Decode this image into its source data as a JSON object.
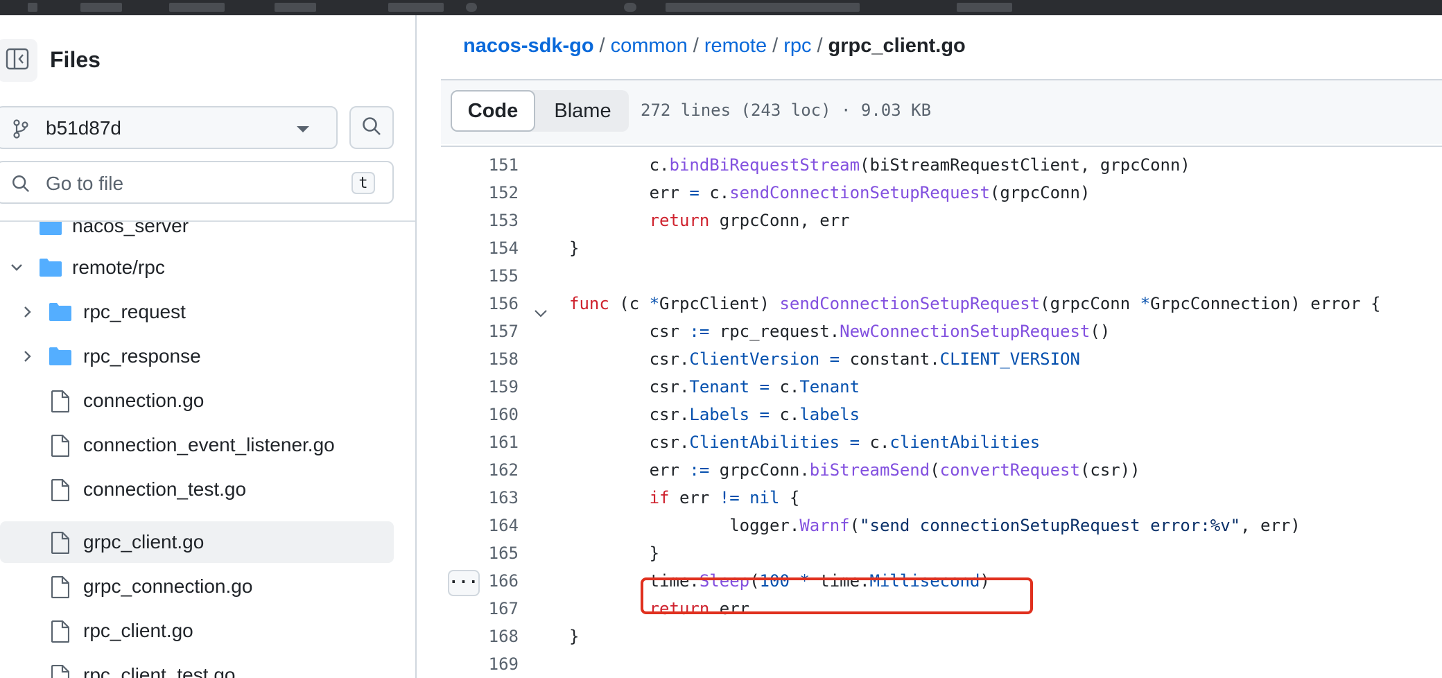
{
  "sidebar": {
    "title": "Files",
    "branch": "b51d87d",
    "go_to_file_placeholder": "Go to file",
    "go_to_file_shortcut": "t",
    "tree": [
      {
        "label": "nacos_server",
        "type": "folder",
        "partial": true
      },
      {
        "label": "remote/rpc",
        "type": "folder",
        "expanded": true
      },
      {
        "label": "rpc_request",
        "type": "folder",
        "expanded": false
      },
      {
        "label": "rpc_response",
        "type": "folder",
        "expanded": false
      },
      {
        "label": "connection.go",
        "type": "file"
      },
      {
        "label": "connection_event_listener.go",
        "type": "file"
      },
      {
        "label": "connection_test.go",
        "type": "file"
      },
      {
        "label": "grpc_client.go",
        "type": "file",
        "selected": true
      },
      {
        "label": "grpc_connection.go",
        "type": "file"
      },
      {
        "label": "rpc_client.go",
        "type": "file"
      },
      {
        "label": "rpc_client_test.go",
        "type": "file"
      }
    ]
  },
  "breadcrumb": {
    "parts": [
      "nacos-sdk-go",
      "common",
      "remote",
      "rpc"
    ],
    "separator": "/",
    "current": "grpc_client.go"
  },
  "toolbar": {
    "code_label": "Code",
    "blame_label": "Blame",
    "file_info": "272 lines (243 loc) · 9.03 KB",
    "expand_label": "···"
  },
  "code": {
    "lines": [
      {
        "num": "151",
        "text": "\t\tc.bindBiRequestStream(biStreamRequestClient, grpcConn)"
      },
      {
        "num": "152",
        "text": "\t\terr = c.sendConnectionSetupRequest(grpcConn)"
      },
      {
        "num": "153",
        "text": "\t\treturn grpcConn, err"
      },
      {
        "num": "154",
        "text": "}"
      },
      {
        "num": "155",
        "text": ""
      },
      {
        "num": "156",
        "text": "func (c *GrpcClient) sendConnectionSetupRequest(grpcConn *GrpcConnection) error {"
      },
      {
        "num": "157",
        "text": "\t\tcsr := rpc_request.NewConnectionSetupRequest()"
      },
      {
        "num": "158",
        "text": "\t\tcsr.ClientVersion = constant.CLIENT_VERSION"
      },
      {
        "num": "159",
        "text": "\t\tcsr.Tenant = c.Tenant"
      },
      {
        "num": "160",
        "text": "\t\tcsr.Labels = c.labels"
      },
      {
        "num": "161",
        "text": "\t\tcsr.ClientAbilities = c.clientAbilities"
      },
      {
        "num": "162",
        "text": "\t\terr := grpcConn.biStreamSend(convertRequest(csr))"
      },
      {
        "num": "163",
        "text": "\t\tif err != nil {"
      },
      {
        "num": "164",
        "text": "\t\t\t\tlogger.Warnf(\"send connectionSetupRequest error:%v\", err)"
      },
      {
        "num": "165",
        "text": "\t\t}"
      },
      {
        "num": "166",
        "text": "\t\ttime.Sleep(100 * time.Millisecond)"
      },
      {
        "num": "167",
        "text": "\t\treturn err"
      },
      {
        "num": "168",
        "text": "}"
      },
      {
        "num": "169",
        "text": ""
      }
    ],
    "highlighted_line": "166"
  },
  "colors": {
    "link": "#0969da",
    "keyword": "#cf222e",
    "function": "#8250df",
    "constant": "#0550ae",
    "highlight_border": "#e0301e"
  }
}
